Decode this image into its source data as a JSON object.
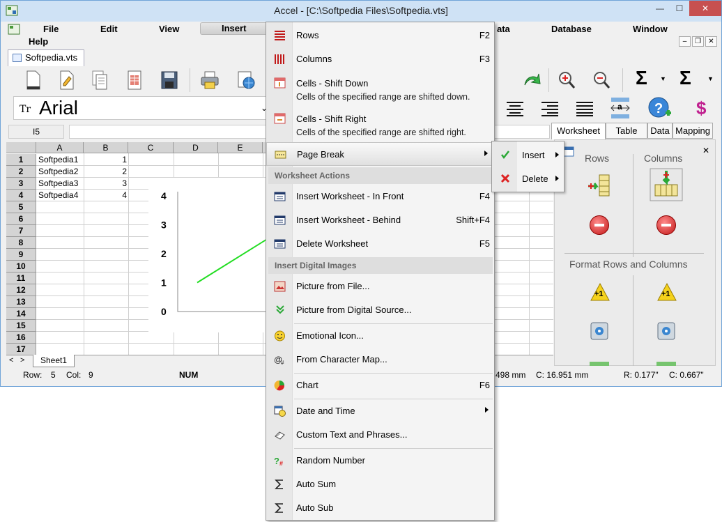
{
  "window": {
    "title": "Accel - [C:\\Softpedia Files\\Softpedia.vts]"
  },
  "titlebar_buttons": {
    "minimize": "—",
    "maximize": "☐",
    "close": "✕"
  },
  "menubar": {
    "items": [
      "File",
      "Edit",
      "View",
      "Insert",
      "ata",
      "Database",
      "Window",
      "Help"
    ]
  },
  "mdi_buttons": {
    "min": "–",
    "restore": "❐",
    "close": "✕"
  },
  "doc_tab": "Softpedia.vts",
  "font": {
    "name": "Arial",
    "glyph": "Tr"
  },
  "cell_ref": "I5",
  "columns": [
    "A",
    "B",
    "C",
    "D",
    "E"
  ],
  "rows": [
    "1",
    "2",
    "3",
    "4",
    "5",
    "6",
    "7",
    "8",
    "9",
    "10",
    "11",
    "12",
    "13",
    "14",
    "15",
    "16",
    "17"
  ],
  "cells": [
    {
      "a": "Softpedia1",
      "b": "1"
    },
    {
      "a": "Softpedia2",
      "b": "2"
    },
    {
      "a": "Softpedia3",
      "b": "3"
    },
    {
      "a": "Softpedia4",
      "b": "4"
    }
  ],
  "chart_data": {
    "type": "line",
    "title": "",
    "xlabel": "",
    "ylabel": "",
    "yticks": [
      "0",
      "1",
      "2",
      "3",
      "4"
    ],
    "ylim": [
      0,
      4
    ],
    "series": [
      {
        "color": "#22dd22",
        "x": [
          1,
          2
        ],
        "values": [
          1,
          2.5
        ]
      }
    ],
    "grid": false
  },
  "sheet_tabs": {
    "nav_left": "<",
    "nav_right": ">",
    "tab": "Sheet1"
  },
  "status": {
    "row_label": "Row:",
    "row_value": "5",
    "col_label": "Col:",
    "col_value": "9",
    "num": "NUM",
    "measure1": "498 mm",
    "measure2": "C: 16.951 mm",
    "measure3": "R: 0.177\"",
    "measure4": "C: 0.667\""
  },
  "right_tabs": [
    "Worksheet",
    "Table",
    "Data",
    "Mapping"
  ],
  "side_panel": {
    "close": "✕",
    "rows_label": "Rows",
    "columns_label": "Columns",
    "format_label": "Format Rows and Columns",
    "badge": "+1"
  },
  "toolbar_glyphs": {
    "sum1": "Σ",
    "sum2": "Σ",
    "dollar": "$",
    "ab": "a"
  },
  "insert_menu": {
    "items": [
      {
        "label": "Rows",
        "shortcut": "F2"
      },
      {
        "label": "Columns",
        "shortcut": "F3"
      },
      {
        "label": "Cells - Shift Down",
        "desc": "Cells of the specified range are shifted down."
      },
      {
        "label": "Cells - Shift Right",
        "desc": "Cells of the specified range are shifted right."
      },
      {
        "label": "Page Break"
      },
      {
        "label": "Insert Worksheet - In Front",
        "shortcut": "F4"
      },
      {
        "label": "Insert Worksheet - Behind",
        "shortcut": "Shift+F4"
      },
      {
        "label": "Delete Worksheet",
        "shortcut": "F5"
      },
      {
        "label": "Picture from File..."
      },
      {
        "label": "Picture from Digital Source..."
      },
      {
        "label": "Emotional Icon..."
      },
      {
        "label": "From Character Map..."
      },
      {
        "label": "Chart",
        "shortcut": "F6"
      },
      {
        "label": "Date and Time"
      },
      {
        "label": "Custom Text and Phrases..."
      },
      {
        "label": "Random Number"
      },
      {
        "label": "Auto Sum"
      },
      {
        "label": "Auto Sub"
      }
    ],
    "sections": [
      "Worksheet Actions",
      "Insert Digital Images"
    ]
  },
  "page_break_submenu": {
    "items": [
      "Insert",
      "Delete"
    ]
  }
}
